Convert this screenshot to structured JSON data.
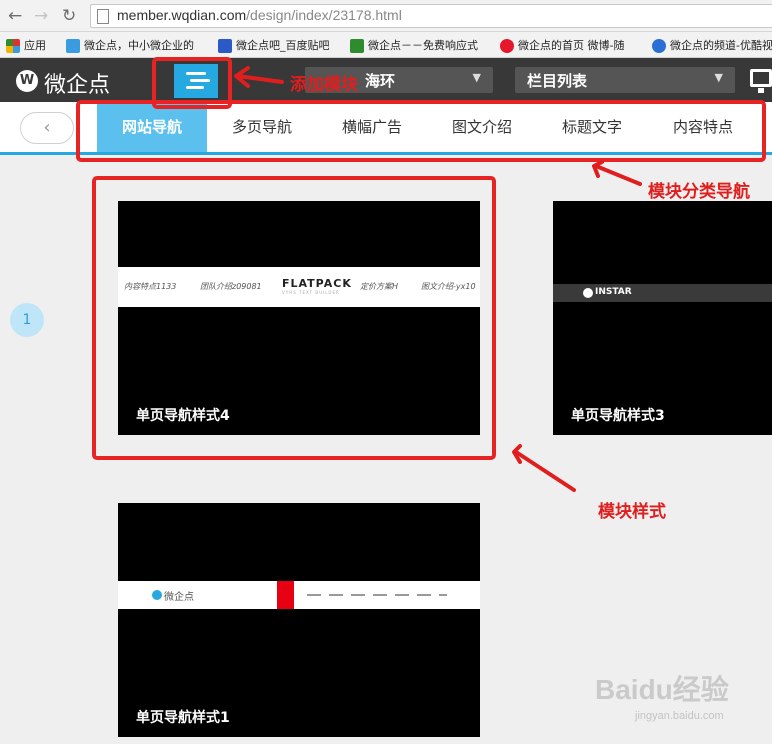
{
  "browser": {
    "url_host": "member.wqdian.com",
    "url_path": "/design/index/23178.html",
    "back": "←",
    "forward": "→",
    "reload": "↻"
  },
  "bookmarks": [
    {
      "label": "应用",
      "icon": "apps-grid-icon",
      "color": "#d33"
    },
    {
      "label": "微企点，中小微企业的",
      "icon": "wqdian-icon",
      "color": "#3a9be0"
    },
    {
      "label": "微企点吧_百度贴吧",
      "icon": "tieba-paw-icon",
      "color": "#2c59c8"
    },
    {
      "label": "微企点－－免费响应式",
      "icon": "douban-icon",
      "color": "#2e8b2e"
    },
    {
      "label": "微企点的首页 微博-随",
      "icon": "weibo-icon",
      "color": "#e6162d"
    },
    {
      "label": "微企点的频道-优酷视",
      "icon": "youku-play-icon",
      "color": "#2a6fd6"
    }
  ],
  "app": {
    "logo_letter": "W",
    "logo_text": "微企点",
    "scene_dropdown": "海环",
    "section_dropdown": "栏目列表",
    "dropdown_caret": "▼",
    "back_arrow": "‹"
  },
  "tabs": [
    {
      "label": "网站导航",
      "active": true
    },
    {
      "label": "多页导航",
      "active": false
    },
    {
      "label": "横幅广告",
      "active": false
    },
    {
      "label": "图文介绍",
      "active": false
    },
    {
      "label": "标题文字",
      "active": false
    },
    {
      "label": "内容特点",
      "active": false
    }
  ],
  "page_number": "1",
  "cards": [
    {
      "title": "单页导航样式4",
      "nav": [
        "内容特点1133",
        "团队介绍z09081",
        "FLATPACK",
        "定价方案H",
        "图文介绍-yx10"
      ],
      "brand_sub": "VYHS TEXT BUILDER"
    },
    {
      "title": "单页导航样式3",
      "brand": "INSTAR"
    },
    {
      "title": "单页导航样式1",
      "brand": "微企点"
    }
  ],
  "annotations": {
    "add_module": "添加模块",
    "category_nav": "模块分类导航",
    "module_style": "模块样式"
  },
  "watermark": {
    "main": "Baidu经验",
    "sub": "jingyan.baidu.com"
  }
}
